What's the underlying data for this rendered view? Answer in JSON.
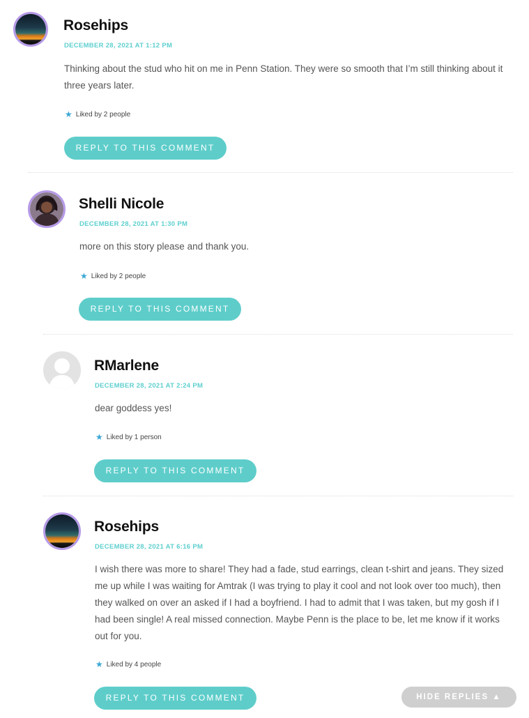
{
  "comments": [
    {
      "author": "Rosehips",
      "date": "DECEMBER 28, 2021 AT 1:12 PM",
      "body": "Thinking about the stud who hit on me in Penn Station. They were so smooth that I’m still thinking about it three years later.",
      "likes": "Liked by 2 people",
      "reply_label": "REPLY TO THIS COMMENT",
      "avatar_icon": "sunset-avatar-icon"
    },
    {
      "author": "Shelli Nicole",
      "date": "DECEMBER 28, 2021 AT 1:30 PM",
      "body": "more on this story please and thank you.",
      "likes": "Liked by 2 people",
      "reply_label": "REPLY TO THIS COMMENT",
      "avatar_icon": "user-photo-avatar-icon"
    },
    {
      "author": "RMarlene",
      "date": "DECEMBER 28, 2021 AT 2:24 PM",
      "body": "dear goddess yes!",
      "likes": "Liked by 1 person",
      "reply_label": "REPLY TO THIS COMMENT",
      "avatar_icon": "default-user-avatar-icon"
    },
    {
      "author": "Rosehips",
      "date": "DECEMBER 28, 2021 AT 6:16 PM",
      "body": "I wish there was more to share! They had a fade, stud earrings, clean t-shirt and jeans. They sized me up while I was waiting for Amtrak (I was trying to play it cool and not look over too much), then they walked on over an asked if I had a boyfriend. I had to admit that I was taken, but my gosh if I had been single! A real missed connection. Maybe Penn is the place to be, let me know if it works out for you.",
      "likes": "Liked by 4 people",
      "reply_label": "REPLY TO THIS COMMENT",
      "avatar_icon": "sunset-avatar-icon"
    }
  ],
  "hide_replies_label": "HIDE REPLIES ▲",
  "colors": {
    "accent": "#5ecdca",
    "date": "#5fcfcf",
    "avatar_border": "#b69ae8",
    "star": "#3aa7d4",
    "hide_button": "#cfcfcf"
  }
}
